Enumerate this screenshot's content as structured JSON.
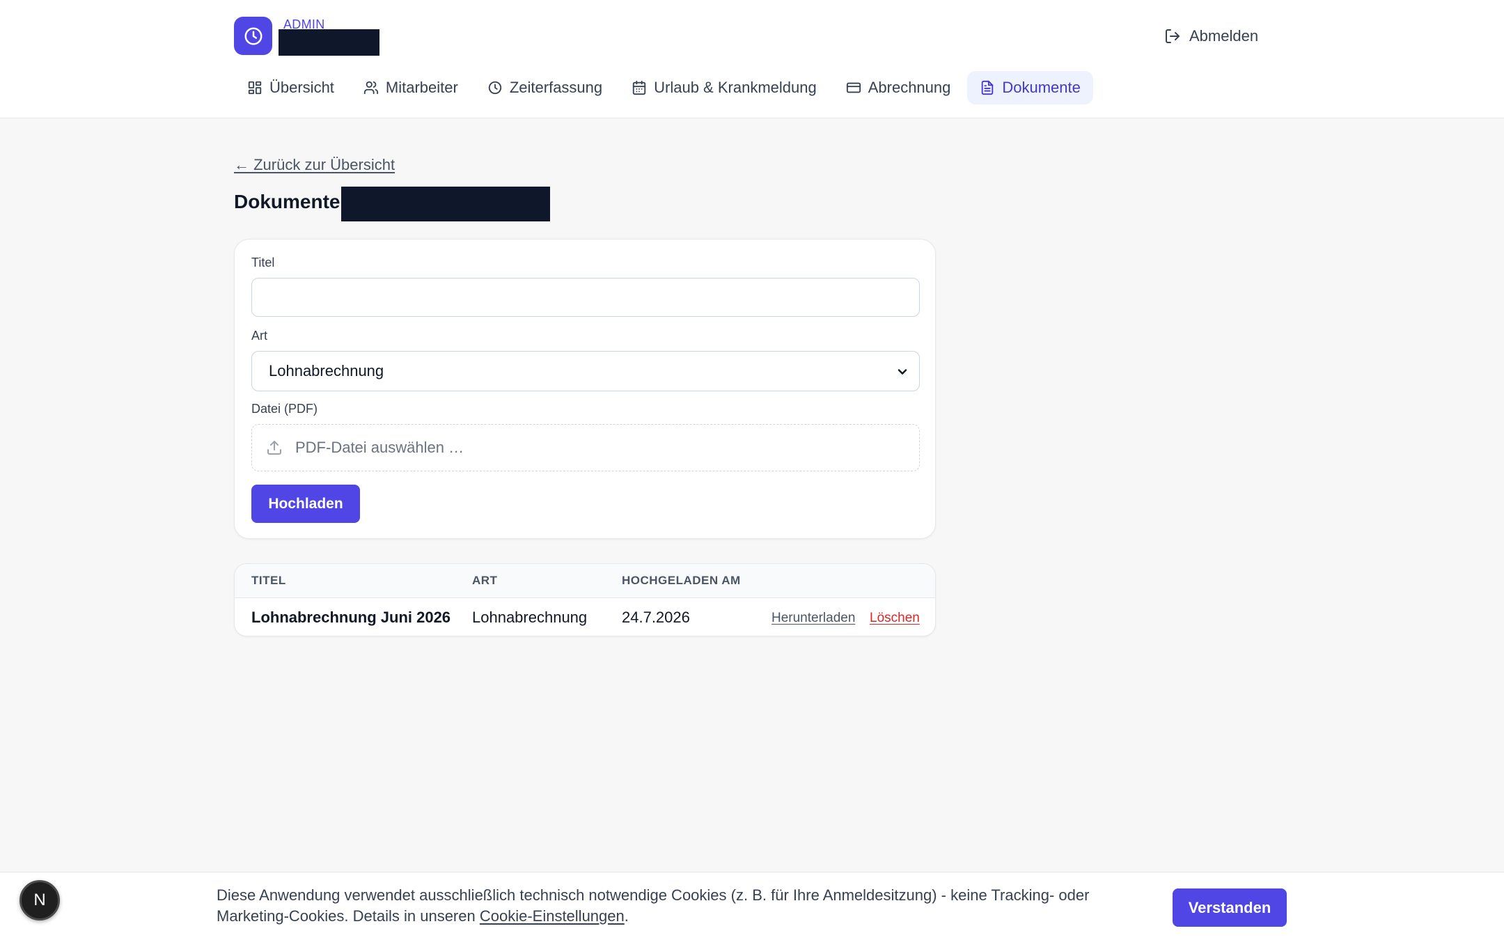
{
  "header": {
    "role_label": "ADMIN",
    "logout_label": "Abmelden",
    "nav": [
      {
        "label": "Übersicht",
        "icon": "grid-icon",
        "active": false
      },
      {
        "label": "Mitarbeiter",
        "icon": "users-icon",
        "active": false
      },
      {
        "label": "Zeiterfassung",
        "icon": "clock-icon",
        "active": false
      },
      {
        "label": "Urlaub & Krankmeldung",
        "icon": "calendar-icon",
        "active": false
      },
      {
        "label": "Abrechnung",
        "icon": "credit-card-icon",
        "active": false
      },
      {
        "label": "Dokumente",
        "icon": "document-icon",
        "active": true
      }
    ]
  },
  "main": {
    "back_link": "← Zurück zur Übersicht",
    "title": "Dokumente:",
    "form": {
      "title_label": "Titel",
      "title_value": "",
      "type_label": "Art",
      "type_value": "Lohnabrechnung",
      "file_label": "Datei (PDF)",
      "file_placeholder": "PDF-Datei auswählen …",
      "submit_label": "Hochladen"
    },
    "table": {
      "headers": [
        "Titel",
        "Art",
        "Hochgeladen am"
      ],
      "rows": [
        {
          "title": "Lohnabrechnung Juni 2026",
          "type": "Lohnabrechnung",
          "uploaded": "24.7.2026",
          "download_label": "Herunterladen",
          "delete_label": "Löschen"
        }
      ]
    }
  },
  "cookie": {
    "text": "Diese Anwendung verwendet ausschließlich technisch notwendige Cookies (z. B. für Ihre Anmeldesitzung) - keine Tracking- oder Marketing-Cookies. Details in unseren ",
    "link_label": "Cookie-Einstellungen",
    "text_end": ".",
    "button_label": "Verstanden"
  },
  "dev_badge": "N",
  "colors": {
    "accent": "#4f46e5",
    "active_nav_bg": "#eef2ff",
    "danger": "#dc2626",
    "redaction": "#0f172a"
  }
}
